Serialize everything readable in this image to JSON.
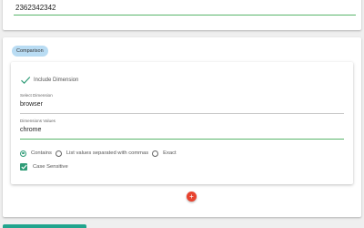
{
  "id_field": {
    "value": "2362342342"
  },
  "comparison": {
    "chip_label": "Comparison",
    "include_dimension_label": "Include Dimension",
    "select_dimension": {
      "label": "Select Dimension",
      "value": "browser"
    },
    "dimension_values": {
      "label": "Dimensions Values",
      "value": "chrome"
    },
    "match_options": [
      {
        "label": "Contains",
        "selected": true
      },
      {
        "label": "List values separated with commas",
        "selected": false
      },
      {
        "label": "Exact",
        "selected": false
      }
    ],
    "case_sensitive": {
      "label": "Case Sensitive",
      "checked": true
    }
  },
  "add_button_glyph": "+",
  "colors": {
    "accent": "#2f9c77",
    "active_underline": "#59b56a",
    "chip_bg": "#b9dcf3",
    "add_button": "#e8432f",
    "bottom_bar": "#22a58e"
  }
}
